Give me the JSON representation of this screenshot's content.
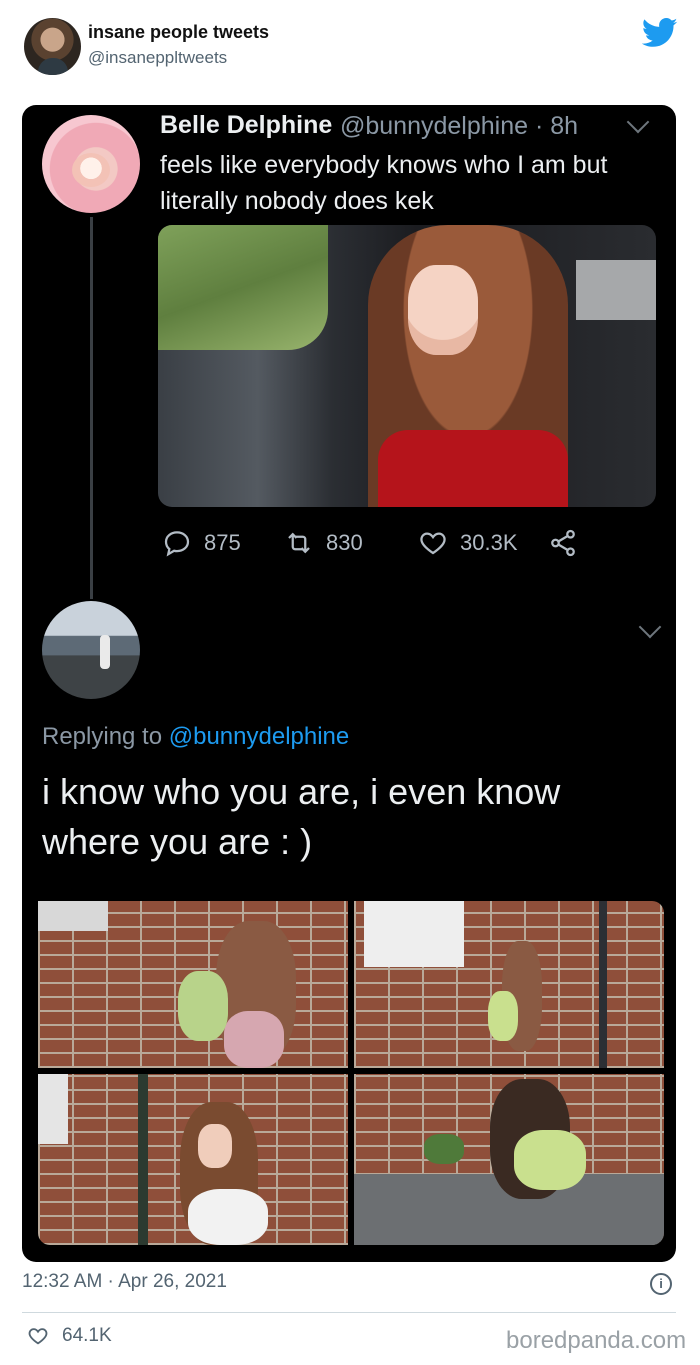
{
  "header": {
    "account_name": "insane people tweets",
    "account_handle": "@insanеppltweets"
  },
  "tweet": {
    "author_name": "Belle Delphine",
    "author_meta": "@bunnydelphine · 8h",
    "text": "feels like everybody knows who I am but literally nobody does kek",
    "replies": "875",
    "retweets": "830",
    "likes": "30.3K"
  },
  "reply": {
    "replying_label": "Replying to",
    "replying_handle": "@bunnydelphine",
    "text": "i know who you are, i even know where you are : )"
  },
  "footer": {
    "timestamp": "12:32 AM · Apr 26, 2021",
    "info_glyph": "i",
    "likes": "64.1K",
    "watermark": "boredpanda.com"
  },
  "colors": {
    "twitter_blue": "#1d9bf0",
    "dark_bg": "#000000",
    "muted_text": "#536471"
  }
}
